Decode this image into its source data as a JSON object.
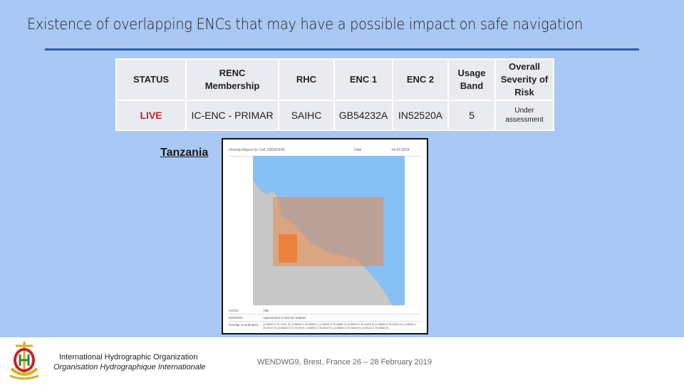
{
  "slide": {
    "title": "Existence of overlapping ENCs that may have a possible impact on safe navigation",
    "colors": {
      "background": "#a9c8f3",
      "rule": "#2a5fb0",
      "live": "#c8202a"
    }
  },
  "table": {
    "headers": [
      "STATUS",
      "RENC Membership",
      "RHC",
      "ENC 1",
      "ENC 2",
      "Usage Band",
      "Overall Severity of Risk"
    ],
    "header_lines": {
      "renc": [
        "RENC",
        "Membership"
      ],
      "usage": [
        "Usage",
        "Band"
      ],
      "severity": [
        "Overall",
        "Severity of",
        "Risk"
      ]
    },
    "row": {
      "status": "LIVE",
      "renc": "IC-ENC - PRIMAR",
      "rhc": "SAIHC",
      "enc1": "GB54232A",
      "enc2": "IN52520A",
      "usage_band": "5",
      "severity_lines": [
        "Under",
        "assessment"
      ]
    }
  },
  "country": "Tanzania",
  "report": {
    "header_title": "Overlap Report for Cell: GB54232A",
    "date_label": "Date",
    "date_value": "14-03-2018",
    "col_cell_id": "Cell ID",
    "col_title": "Title",
    "cell_id": "IN52520A",
    "cell_title": "Approaches to Dar Es Salaam",
    "overlap_label": "Overlap Coordinates:",
    "overlap_coords": "(-6.85833 S 39.29167 E) (-6.85833 S 39.28889 E) (-6.85833 S 39.28882 E) (-6.85833 S 39.29695 E) (-6.85833 S 39.29633 E) (-6.85833 S 39.29130 E) (-6.85833 S 39.29145 E) (-6.85833 S 39.28449 E) (-6.85833 S 39.28343 E) (-6.85144 S 39.28883 E)"
  },
  "footer": {
    "org_en": "International Hydrographic Organization",
    "org_fr": "Organisation Hydrographique Internationale",
    "event": "WENDWG9, Brest, France 26 – 28 February 2019"
  }
}
